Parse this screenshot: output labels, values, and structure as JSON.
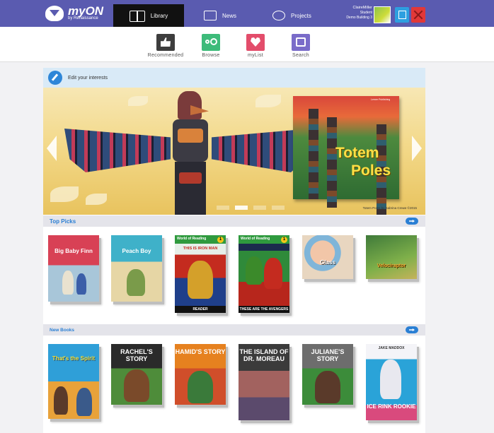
{
  "topnav": {
    "logo": {
      "text": "myON",
      "sub": "by Renaissance"
    },
    "tabs": [
      {
        "label": "Library",
        "icon": "book-icon",
        "active": true
      },
      {
        "label": "News",
        "icon": "newspaper-icon",
        "active": false
      },
      {
        "label": "Projects",
        "icon": "projects-icon",
        "active": false
      }
    ],
    "user": {
      "name": "ClaireMiller",
      "role": "Student",
      "school": "Demo Building 3"
    },
    "colors": {
      "bar": "#5a5bb0",
      "active_tab": "#111111",
      "export": "#2e9fe0",
      "logout": "#e13838"
    }
  },
  "subnav": {
    "items": [
      {
        "label": "Recommended",
        "icon": "thumbs-up-icon",
        "color": "#3d3d3d"
      },
      {
        "label": "Browse",
        "icon": "glasses-icon",
        "color": "#3dbb7a"
      },
      {
        "label": "myList",
        "icon": "heart-icon",
        "color": "#e34d6b"
      },
      {
        "label": "Search",
        "icon": "search-icon",
        "color": "#7a6cc9"
      }
    ]
  },
  "interests": {
    "label": "Edit your interests",
    "icon": "pencil-icon"
  },
  "carousel": {
    "featured": {
      "title_line1": "Totem",
      "title_line2": "Poles",
      "publisher": "Lerner Publishing"
    },
    "caption": "Totem Poles by Sabrina Crewe ©2015",
    "slides": 4,
    "active_slide": 2
  },
  "sections": {
    "top_picks": {
      "title": "Top Picks",
      "books": [
        {
          "title": "Big Baby Finn"
        },
        {
          "title": "Peach Boy"
        },
        {
          "band": "World of Reading",
          "level": "1",
          "title": "THIS IS IRON MAN",
          "footer": "READER"
        },
        {
          "band": "World of Reading",
          "level": "1",
          "title": "THESE ARE THE AVENGERS"
        },
        {
          "title": "Glass"
        },
        {
          "title": "Velociraptor"
        }
      ]
    },
    "new_books": {
      "title": "New Books",
      "books": [
        {
          "title": "That's the Spirit"
        },
        {
          "title": "RACHEL'S STORY"
        },
        {
          "title": "HAMID'S STORY"
        },
        {
          "title": "THE ISLAND OF DR. MOREAU"
        },
        {
          "title": "JULIANE'S STORY"
        },
        {
          "author": "JAKE MADDOX",
          "title": "ICE RINK ROOKIE"
        }
      ]
    }
  }
}
